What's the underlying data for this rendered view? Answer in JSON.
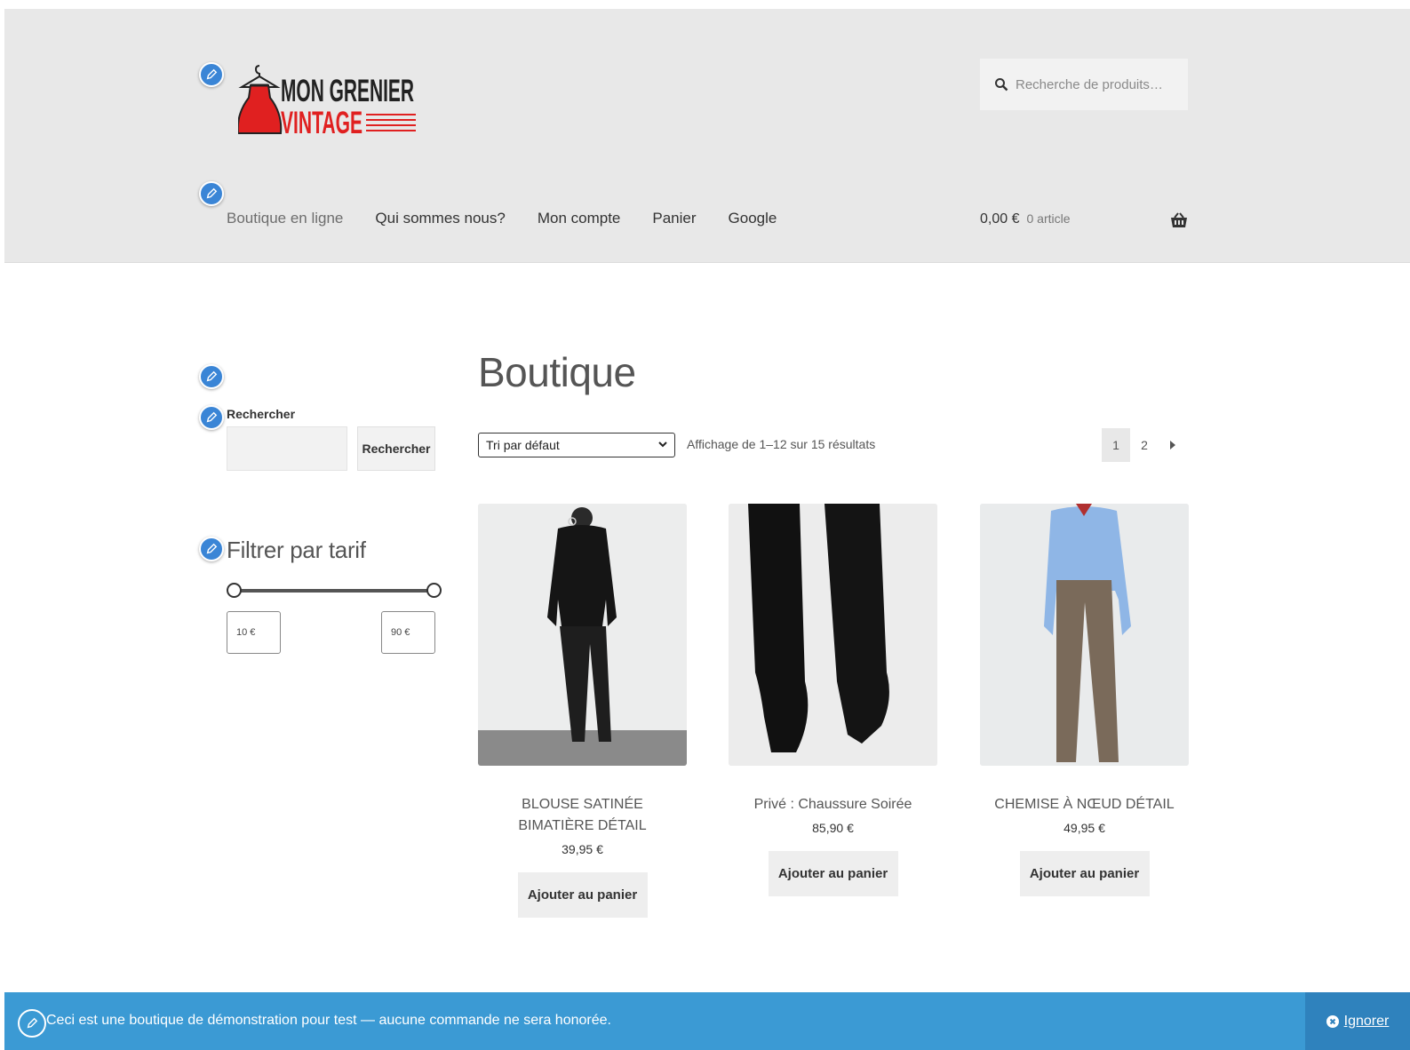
{
  "header": {
    "logo": {
      "line1": "MON GRENIER",
      "line2": "VINTAGE",
      "icon": "dress-hanger-logo"
    },
    "search": {
      "placeholder": "Recherche de produits…",
      "icon": "search-icon"
    },
    "nav": [
      {
        "label": "Boutique en ligne"
      },
      {
        "label": "Qui sommes nous?"
      },
      {
        "label": "Mon compte"
      },
      {
        "label": "Panier"
      },
      {
        "label": "Google"
      }
    ],
    "cart": {
      "total": "0,00 €",
      "count": "0 article",
      "icon": "basket-icon"
    }
  },
  "sidebar": {
    "search_label": "Rechercher",
    "search_button": "Rechercher",
    "filter_title": "Filtrer par tarif",
    "price_min": "10 €",
    "price_max": "90 €"
  },
  "main": {
    "title": "Boutique",
    "sort": {
      "selected": "Tri par défaut"
    },
    "result_count": "Affichage de 1–12 sur 15 résultats",
    "pagination": {
      "pages": [
        "1",
        "2"
      ],
      "current": "1",
      "next_icon": "caret-right-icon"
    },
    "products": [
      {
        "name": "BLOUSE SATINÉE BIMATIÈRE DÉTAIL",
        "price": "39,95 €",
        "button": "Ajouter au panier"
      },
      {
        "name": "Privé : Chaussure Soirée",
        "price": "85,90 €",
        "button": "Ajouter au panier"
      },
      {
        "name": "CHEMISE À NŒUD DÉTAIL",
        "price": "49,95 €",
        "button": "Ajouter au panier"
      }
    ]
  },
  "notice": {
    "message": "Ceci est une boutique de démonstration pour test — aucune commande ne sera honorée.",
    "dismiss": "Ignorer"
  },
  "colors": {
    "notice_bg": "#3b9ad4",
    "edit_pin": "#3a85d6",
    "logo_red": "#e02020"
  }
}
